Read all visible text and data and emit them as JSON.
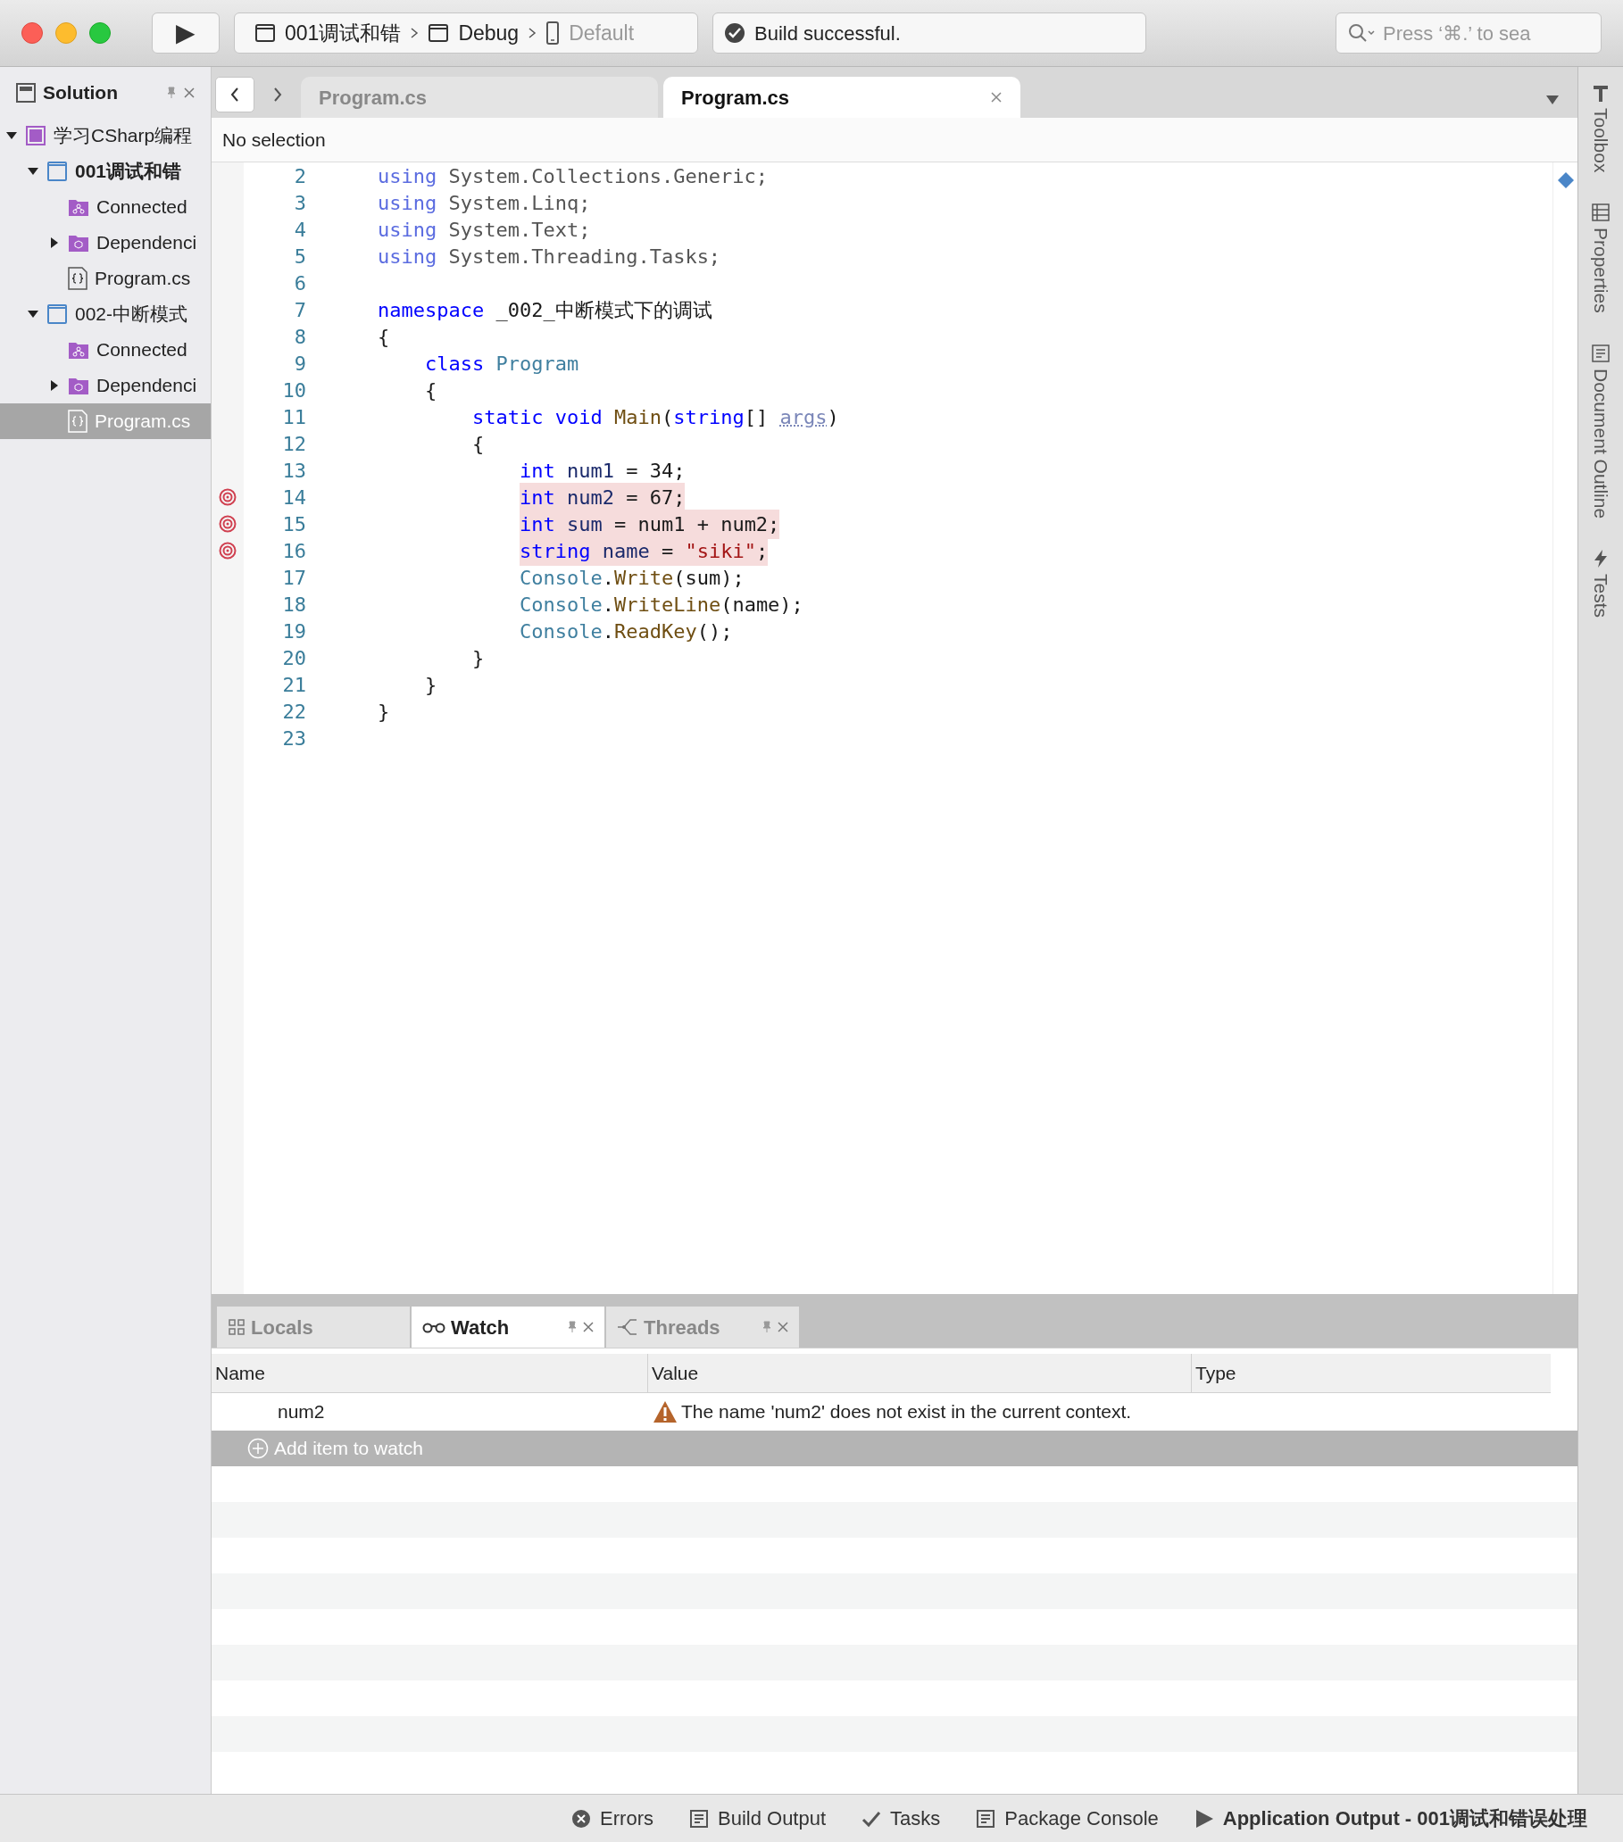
{
  "toolbar": {
    "run_button": "▶",
    "breadcrumb": [
      {
        "label": "001调试和错",
        "kind": "project"
      },
      {
        "label": "Debug",
        "kind": "config"
      },
      {
        "label": "Default",
        "kind": "device"
      }
    ],
    "status": "Build successful.",
    "search": {
      "placeholder": "Press ‘⌘.’ to sea"
    }
  },
  "sidebar": {
    "title": "Solution",
    "tree": [
      {
        "label": "学习CSharp编程",
        "kind": "solution",
        "expanded": true,
        "selected": false,
        "bold": false,
        "children": [
          {
            "label": "001调试和错",
            "kind": "project",
            "expanded": true,
            "selected": false,
            "bold": true,
            "children": [
              {
                "label": "Connected",
                "kind": "services",
                "selected": false,
                "bold": false
              },
              {
                "label": "Dependenci",
                "kind": "dependencies",
                "expanded": false,
                "selected": false,
                "bold": false
              },
              {
                "label": "Program.cs",
                "kind": "file",
                "selected": false,
                "bold": false
              }
            ]
          },
          {
            "label": "002-中断模式",
            "kind": "project",
            "expanded": true,
            "selected": false,
            "bold": false,
            "children": [
              {
                "label": "Connected",
                "kind": "services",
                "selected": false,
                "bold": false
              },
              {
                "label": "Dependenci",
                "kind": "dependencies",
                "expanded": false,
                "selected": false,
                "bold": false
              },
              {
                "label": "Program.cs",
                "kind": "file",
                "selected": true,
                "bold": false
              }
            ]
          }
        ]
      }
    ]
  },
  "editor": {
    "tabs": [
      {
        "label": "Program.cs",
        "selected": false
      },
      {
        "label": "Program.cs",
        "selected": true
      }
    ],
    "path_bar": "No selection",
    "lines": [
      {
        "number": "2",
        "tokens": [
          {
            "kind": "kw2",
            "text": "using"
          },
          {
            "kind": "plain",
            "text": " System.Collections.Generic;"
          }
        ]
      },
      {
        "number": "3",
        "tokens": [
          {
            "kind": "kw2",
            "text": "using"
          },
          {
            "kind": "plain",
            "text": " System.Linq;"
          }
        ]
      },
      {
        "number": "4",
        "tokens": [
          {
            "kind": "kw2",
            "text": "using"
          },
          {
            "kind": "plain",
            "text": " System.Text;"
          }
        ]
      },
      {
        "number": "5",
        "tokens": [
          {
            "kind": "kw2",
            "text": "using"
          },
          {
            "kind": "plain",
            "text": " System.Threading.Tasks;"
          }
        ]
      },
      {
        "number": "6"
      },
      {
        "number": "7",
        "tokens": [
          {
            "kind": "kw",
            "text": "namespace"
          },
          {
            "kind": "ident",
            "text": " _002_中断模式下的调试"
          }
        ]
      },
      {
        "number": "8",
        "tokens": [
          {
            "kind": "ident",
            "text": "{"
          }
        ]
      },
      {
        "number": "9",
        "tokens": [
          {
            "kind": "kw",
            "text": "    class"
          },
          {
            "kind": "type",
            "text": " Program"
          }
        ]
      },
      {
        "number": "10",
        "tokens": [
          {
            "kind": "ident",
            "text": "    {"
          }
        ]
      },
      {
        "number": "11",
        "tokens": [
          {
            "kind": "kw",
            "text": "        static void"
          },
          {
            "kind": "method",
            "text": " Main"
          },
          {
            "kind": "ident",
            "text": "("
          },
          {
            "kind": "kw",
            "text": "string"
          },
          {
            "kind": "ident",
            "text": "[] "
          },
          {
            "kind": "param",
            "text": "args"
          },
          {
            "kind": "ident",
            "text": ")"
          }
        ]
      },
      {
        "number": "12",
        "tokens": [
          {
            "kind": "ident",
            "text": "        {"
          }
        ]
      },
      {
        "number": "13",
        "tokens": [
          {
            "kind": "kw",
            "text": "            int"
          },
          {
            "kind": "var",
            "text": " num1"
          },
          {
            "kind": "ident",
            "text": " = 34;"
          }
        ]
      },
      {
        "number": "14",
        "breakpoint": true,
        "tokens": [
          {
            "kind": "kw",
            "text": "            int"
          },
          {
            "kind": "var",
            "text": " num2"
          },
          {
            "kind": "ident",
            "text": " = 67;"
          }
        ]
      },
      {
        "number": "15",
        "breakpoint": true,
        "tokens": [
          {
            "kind": "kw",
            "text": "            int"
          },
          {
            "kind": "var",
            "text": " sum"
          },
          {
            "kind": "ident",
            "text": " = num1 + num2;"
          }
        ]
      },
      {
        "number": "16",
        "breakpoint": true,
        "tokens": [
          {
            "kind": "kw",
            "text": "            string"
          },
          {
            "kind": "var",
            "text": " name"
          },
          {
            "kind": "ident",
            "text": " = "
          },
          {
            "kind": "str",
            "text": "\"siki\""
          },
          {
            "kind": "ident",
            "text": ";"
          }
        ]
      },
      {
        "number": "17",
        "tokens": [
          {
            "kind": "type",
            "text": "            Console"
          },
          {
            "kind": "ident",
            "text": "."
          },
          {
            "kind": "method",
            "text": "Write"
          },
          {
            "kind": "ident",
            "text": "(sum);"
          }
        ]
      },
      {
        "number": "18",
        "tokens": [
          {
            "kind": "type",
            "text": "            Console"
          },
          {
            "kind": "ident",
            "text": "."
          },
          {
            "kind": "method",
            "text": "WriteLine"
          },
          {
            "kind": "ident",
            "text": "(name);"
          }
        ]
      },
      {
        "number": "19",
        "tokens": [
          {
            "kind": "type",
            "text": "            Console"
          },
          {
            "kind": "ident",
            "text": "."
          },
          {
            "kind": "method",
            "text": "ReadKey"
          },
          {
            "kind": "ident",
            "text": "();"
          }
        ]
      },
      {
        "number": "20",
        "tokens": [
          {
            "kind": "ident",
            "text": "        }"
          }
        ]
      },
      {
        "number": "21",
        "tokens": [
          {
            "kind": "ident",
            "text": "    }"
          }
        ]
      },
      {
        "number": "22",
        "tokens": [
          {
            "kind": "ident",
            "text": "}"
          }
        ]
      },
      {
        "number": "23"
      }
    ]
  },
  "debug_panel": {
    "tabs": [
      {
        "label": "Locals",
        "kind": "locals",
        "selected": false
      },
      {
        "label": "Watch",
        "kind": "watch",
        "selected": true
      },
      {
        "label": "Threads",
        "kind": "threads",
        "selected": false
      }
    ],
    "columns": [
      "Name",
      "Value",
      "Type"
    ],
    "rows": [
      {
        "name": "num2",
        "value": "The name 'num2' does not exist in the current context.",
        "warning": true
      }
    ],
    "add_item": "Add item to watch"
  },
  "right_rail": [
    {
      "label": "Toolbox",
      "kind": "toolbox"
    },
    {
      "label": "Properties",
      "kind": "properties"
    },
    {
      "label": "Document Outline",
      "kind": "outline"
    },
    {
      "label": "Tests",
      "kind": "tests"
    }
  ],
  "status_bar": [
    {
      "label": "Errors",
      "kind": "errors",
      "bold": false
    },
    {
      "label": "Build Output",
      "kind": "output",
      "bold": false
    },
    {
      "label": "Tasks",
      "kind": "tasks",
      "bold": false
    },
    {
      "label": "Package Console",
      "kind": "output",
      "bold": false
    },
    {
      "label": "Application Output - 001调试和错误处理",
      "kind": "app",
      "bold": true
    }
  ]
}
